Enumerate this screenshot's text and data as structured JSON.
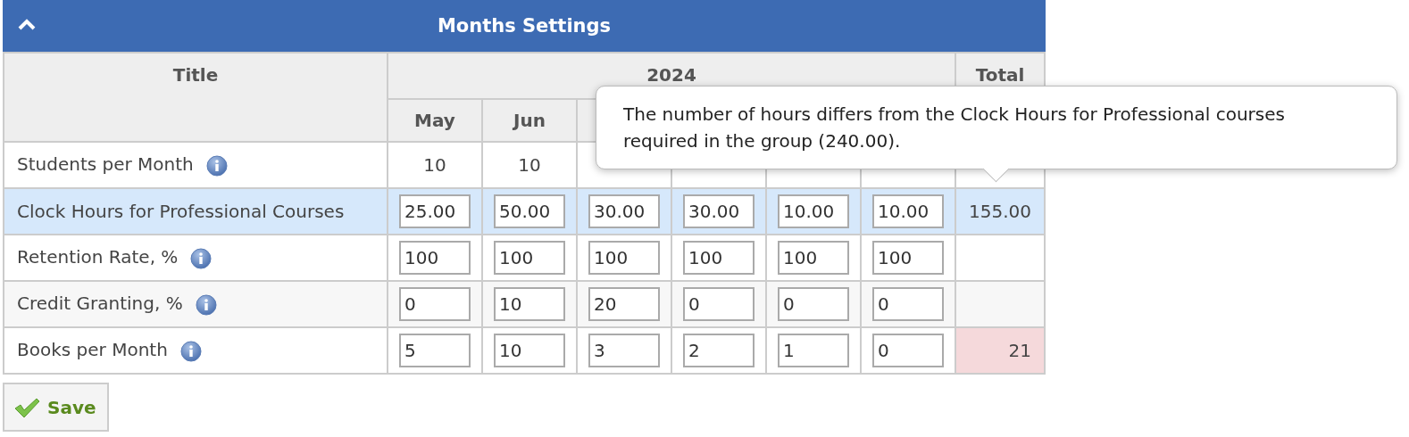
{
  "panel": {
    "title": "Months Settings",
    "expanded": true
  },
  "table": {
    "title_header": "Title",
    "year": "2024",
    "total_header": "Total",
    "months": [
      "May",
      "Jun"
    ],
    "rows": [
      {
        "title": "Students per Month",
        "info": true,
        "kind": "display",
        "selected": false,
        "values": [
          "10",
          "10"
        ]
      },
      {
        "title": "Clock Hours for Professional Courses",
        "info": false,
        "kind": "input",
        "selected": true,
        "values": [
          "25.00",
          "50.00",
          "30.00",
          "30.00",
          "10.00",
          "10.00"
        ],
        "total": {
          "text": "155.00",
          "warning": false
        }
      },
      {
        "title": "Retention Rate, %",
        "info": true,
        "kind": "input",
        "selected": false,
        "values": [
          "100",
          "100",
          "100",
          "100",
          "100",
          "100"
        ]
      },
      {
        "title": "Credit Granting, %",
        "info": true,
        "kind": "input",
        "selected": false,
        "values": [
          "0",
          "10",
          "20",
          "0",
          "0",
          "0"
        ]
      },
      {
        "title": "Books per Month",
        "info": true,
        "kind": "input",
        "selected": false,
        "values": [
          "5",
          "10",
          "3",
          "2",
          "1",
          "0"
        ],
        "total": {
          "text": "21",
          "warning": true
        }
      }
    ]
  },
  "tooltip": {
    "text": "The number of hours differs from the Clock Hours for Professional courses required in the group (240.00)."
  },
  "save_button": {
    "label": "Save"
  }
}
